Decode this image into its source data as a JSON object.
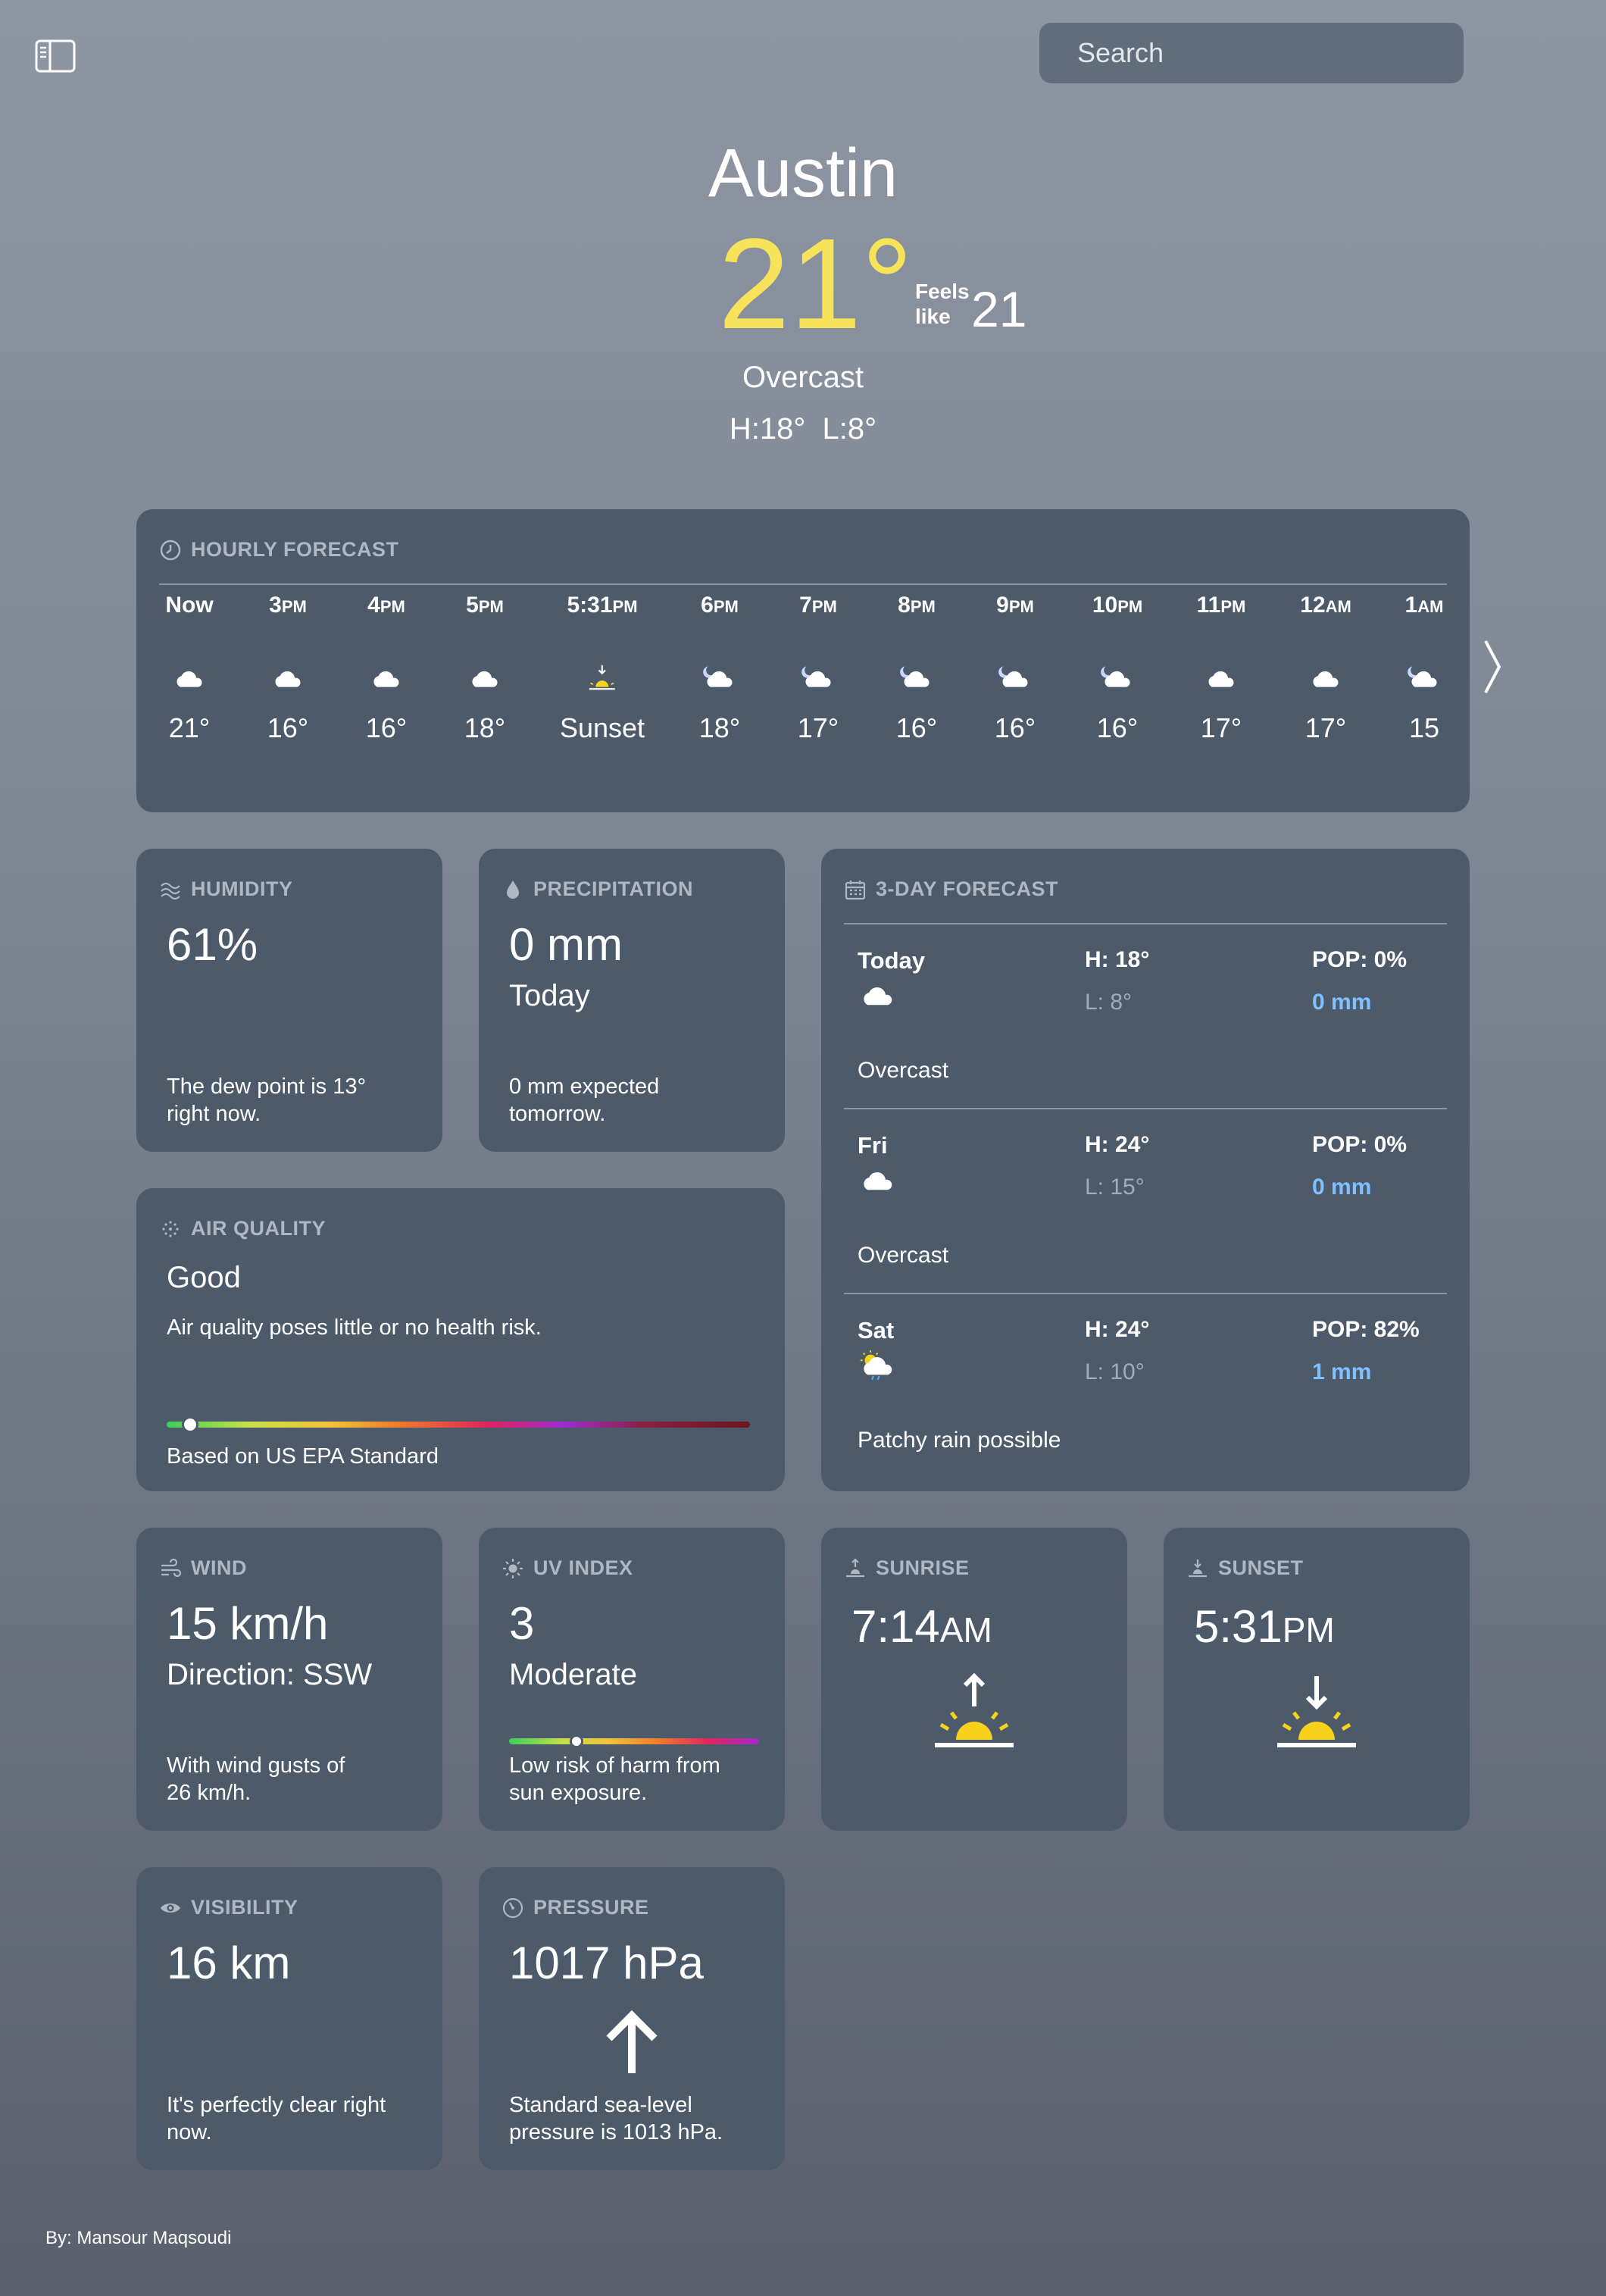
{
  "search": {
    "placeholder": "Search"
  },
  "hero": {
    "city": "Austin",
    "temp": "21°",
    "feels_label_1": "Feels",
    "feels_label_2": "like",
    "feels_value": "21",
    "condition": "Overcast",
    "high_low": "H:18°  L:8°"
  },
  "hourly": {
    "title": "HOURLY FORECAST",
    "items": [
      {
        "time": "Now",
        "suffix": "",
        "icon": "cloud-icon",
        "temp": "21°"
      },
      {
        "time": "3",
        "suffix": "PM",
        "icon": "cloud-icon",
        "temp": "16°"
      },
      {
        "time": "4",
        "suffix": "PM",
        "icon": "cloud-icon",
        "temp": "16°"
      },
      {
        "time": "5",
        "suffix": "PM",
        "icon": "cloud-icon",
        "temp": "18°"
      },
      {
        "time": "5:31",
        "suffix": "PM",
        "icon": "sunset-icon",
        "temp": "Sunset"
      },
      {
        "time": "6",
        "suffix": "PM",
        "icon": "moon-cloud-icon",
        "temp": "18°"
      },
      {
        "time": "7",
        "suffix": "PM",
        "icon": "moon-cloud-icon",
        "temp": "17°"
      },
      {
        "time": "8",
        "suffix": "PM",
        "icon": "moon-cloud-icon",
        "temp": "16°"
      },
      {
        "time": "9",
        "suffix": "PM",
        "icon": "moon-cloud-icon",
        "temp": "16°"
      },
      {
        "time": "10",
        "suffix": "PM",
        "icon": "moon-cloud-icon",
        "temp": "16°"
      },
      {
        "time": "11",
        "suffix": "PM",
        "icon": "cloud-icon",
        "temp": "17°"
      },
      {
        "time": "12",
        "suffix": "AM",
        "icon": "cloud-icon",
        "temp": "17°"
      },
      {
        "time": "1",
        "suffix": "AM",
        "icon": "moon-cloud-icon",
        "temp": "15"
      }
    ]
  },
  "humidity": {
    "title": "HUMIDITY",
    "value": "61%",
    "desc_1": "The dew point is 13°",
    "desc_2": "right now."
  },
  "precipitation": {
    "title": "PRECIPITATION",
    "value": "0 mm",
    "sub": "Today",
    "desc_1": "0 mm expected",
    "desc_2": "tomorrow."
  },
  "forecast": {
    "title": "3-DAY FORECAST",
    "days": [
      {
        "day": "Today",
        "high": "H: 18°",
        "low": "L: 8°",
        "pop": "POP: 0%",
        "mm": "0 mm",
        "cond": "Overcast",
        "icon": "cloud-icon"
      },
      {
        "day": "Fri",
        "high": "H: 24°",
        "low": "L: 15°",
        "pop": "POP: 0%",
        "mm": "0 mm",
        "cond": "Overcast",
        "icon": "cloud-icon"
      },
      {
        "day": "Sat",
        "high": "H: 24°",
        "low": "L: 10°",
        "pop": "POP: 82%",
        "mm": "1 mm",
        "cond": "Patchy rain possible",
        "icon": "sun-rain-cloud-icon"
      }
    ]
  },
  "air_quality": {
    "title": "AIR QUALITY",
    "value": "Good",
    "desc": "Air quality poses little or no health risk.",
    "standard": "Based on US EPA Standard",
    "level_fraction": 0.04
  },
  "wind": {
    "title": "WIND",
    "value": "15 km/h",
    "direction": "Direction: SSW",
    "desc_1": "With wind gusts of",
    "desc_2": "26 km/h."
  },
  "uv": {
    "title": "UV INDEX",
    "value": "3",
    "level": "Moderate",
    "desc_1": "Low risk of harm from",
    "desc_2": "sun exposure.",
    "level_fraction": 0.27
  },
  "sunrise": {
    "title": "SUNRISE",
    "time": "7:14",
    "suffix": "AM"
  },
  "sunset": {
    "title": "SUNSET",
    "time": "5:31",
    "suffix": "PM"
  },
  "visibility": {
    "title": "VISIBILITY",
    "value": "16 km",
    "desc_1": "It's perfectly clear right",
    "desc_2": "now."
  },
  "pressure": {
    "title": "PRESSURE",
    "value": "1017 hPa",
    "desc_1": "Standard sea-level",
    "desc_2": "pressure is 1013 hPa."
  },
  "footer": "By: Mansour Maqsoudi",
  "colors": {
    "temp": "#f6e35a",
    "card": "#4d5a69",
    "rain": "#7fc0ff"
  }
}
